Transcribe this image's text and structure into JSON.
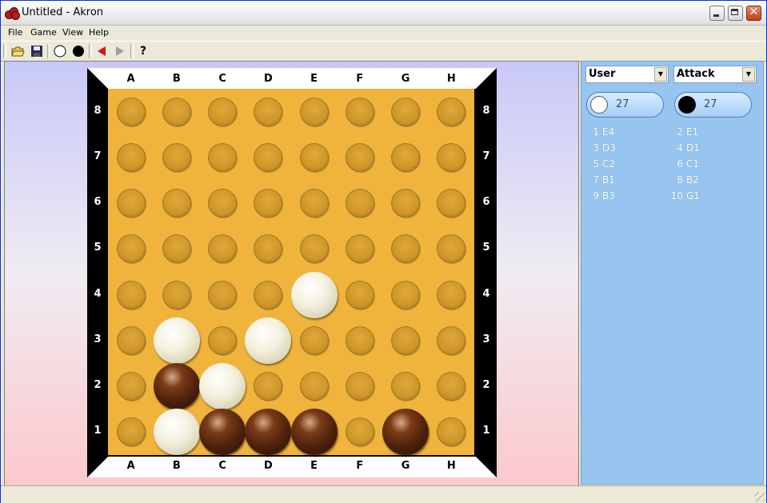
{
  "window": {
    "title": "Untitled - Akron"
  },
  "menu": {
    "file": "File",
    "game": "Game",
    "view": "View",
    "help": "Help"
  },
  "toolbar": {
    "icons": [
      "open-folder-icon",
      "save-disk-icon",
      "white-stone-icon",
      "black-stone-icon",
      "undo-arrow-icon",
      "redo-arrow-icon",
      "help-icon"
    ],
    "help_glyph": "?"
  },
  "board": {
    "columns": [
      "A",
      "B",
      "C",
      "D",
      "E",
      "F",
      "G",
      "H"
    ],
    "rows": [
      "8",
      "7",
      "6",
      "5",
      "4",
      "3",
      "2",
      "1"
    ],
    "stones": [
      {
        "col": "E",
        "row": "4",
        "color": "white"
      },
      {
        "col": "B",
        "row": "3",
        "color": "white"
      },
      {
        "col": "D",
        "row": "3",
        "color": "white"
      },
      {
        "col": "B",
        "row": "2",
        "color": "black"
      },
      {
        "col": "C",
        "row": "2",
        "color": "white"
      },
      {
        "col": "B",
        "row": "1",
        "color": "white"
      },
      {
        "col": "C",
        "row": "1",
        "color": "black"
      },
      {
        "col": "D",
        "row": "1",
        "color": "black"
      },
      {
        "col": "E",
        "row": "1",
        "color": "black"
      },
      {
        "col": "G",
        "row": "1",
        "color": "black"
      }
    ]
  },
  "side": {
    "player_white": "User",
    "player_black": "Attack",
    "white_count": "27",
    "black_count": "27",
    "moves": [
      {
        "n": "1",
        "move": "E4"
      },
      {
        "n": "2",
        "move": "E1"
      },
      {
        "n": "3",
        "move": "D3"
      },
      {
        "n": "4",
        "move": "D1"
      },
      {
        "n": "5",
        "move": "C2"
      },
      {
        "n": "6",
        "move": "C1"
      },
      {
        "n": "7",
        "move": "B1"
      },
      {
        "n": "8",
        "move": "B2"
      },
      {
        "n": "9",
        "move": "B3"
      },
      {
        "n": "10",
        "move": "G1"
      }
    ]
  },
  "colors": {
    "board_field": "#f0b43c",
    "panel": "#97c5f0",
    "white_stone": "#f4f1e0",
    "black_stone": "#4a200a"
  }
}
